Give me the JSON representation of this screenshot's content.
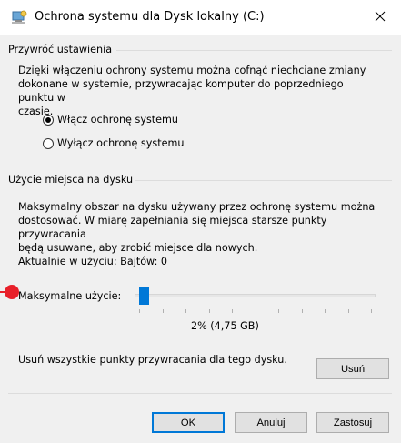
{
  "window": {
    "title": "Ochrona systemu dla Dysk lokalny (C:)",
    "close_symbol": "✕"
  },
  "restore": {
    "header": "Przywróć ustawienia",
    "description_lines": [
      "Dzięki włączeniu ochrony systemu można cofnąć niechciane zmiany",
      "dokonane w systemie, przywracając komputer do poprzedniego punktu w",
      "czasie."
    ],
    "options": [
      {
        "label": "Włącz ochronę systemu",
        "checked": true
      },
      {
        "label": "Wyłącz ochronę systemu",
        "checked": false
      }
    ]
  },
  "disk_usage": {
    "header": "Użycie miejsca na dysku",
    "description_lines": [
      "Maksymalny obszar na dysku używany przez ochronę systemu można",
      "dostosować. W miarę zapełniania się miejsca starsze punkty przywracania",
      "będą usuwane, aby zrobić miejsce dla nowych."
    ],
    "current_usage": "Aktualnie w użyciu: Bajtów: 0",
    "max_usage_label": "Maksymalne użycie:",
    "max_usage_percent": 2,
    "max_usage_value": "2% (4,75 GB)",
    "delete_text": "Usuń wszystkie punkty przywracania dla tego dysku.",
    "delete_button": "Usuń"
  },
  "buttons": {
    "ok": "OK",
    "cancel": "Anuluj",
    "apply": "Zastosuj"
  },
  "colors": {
    "accent": "#0078d7",
    "marker": "#e8202a"
  }
}
